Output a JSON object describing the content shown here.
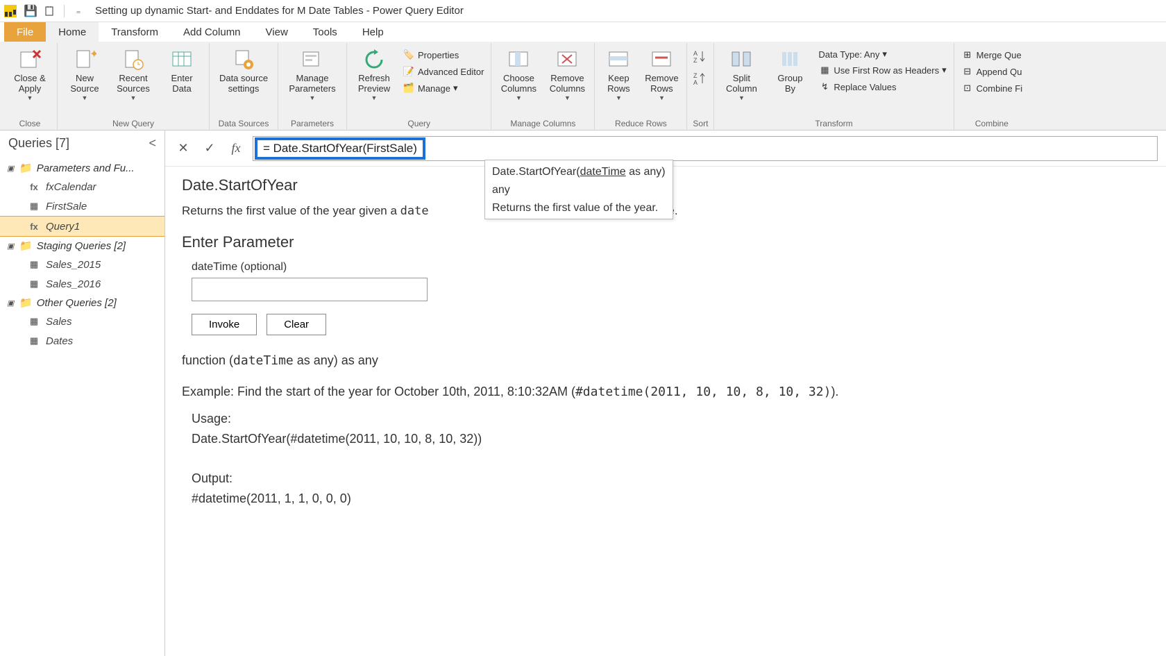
{
  "titlebar": {
    "title": "Setting up dynamic Start- and Enddates for M Date Tables - Power Query Editor"
  },
  "tabs": {
    "file": "File",
    "home": "Home",
    "transform": "Transform",
    "addcolumn": "Add Column",
    "view": "View",
    "tools": "Tools",
    "help": "Help"
  },
  "ribbon": {
    "close": {
      "label": "Close &\nApply",
      "group": "Close"
    },
    "newquery": {
      "newsource": "New\nSource",
      "recentsources": "Recent\nSources",
      "enterdata": "Enter\nData",
      "group": "New Query"
    },
    "datasources": {
      "settings": "Data source\nsettings",
      "group": "Data Sources"
    },
    "parameters": {
      "manage": "Manage\nParameters",
      "group": "Parameters"
    },
    "query": {
      "refresh": "Refresh\nPreview",
      "properties": "Properties",
      "advanced": "Advanced Editor",
      "manage": "Manage",
      "group": "Query"
    },
    "managecols": {
      "choose": "Choose\nColumns",
      "remove": "Remove\nColumns",
      "group": "Manage Columns"
    },
    "reducerows": {
      "keep": "Keep\nRows",
      "remove": "Remove\nRows",
      "group": "Reduce Rows"
    },
    "sort": {
      "group": "Sort"
    },
    "transform": {
      "split": "Split\nColumn",
      "groupby": "Group\nBy",
      "datatype": "Data Type: Any",
      "firstrow": "Use First Row as Headers",
      "replace": "Replace Values",
      "group": "Transform"
    },
    "combine": {
      "merge": "Merge Que",
      "append": "Append Qu",
      "combinefiles": "Combine Fi",
      "group": "Combine"
    }
  },
  "sidebar": {
    "title": "Queries [7]",
    "groups": [
      {
        "label": "Parameters and Fu...",
        "items": [
          {
            "name": "fxCalendar",
            "type": "fx"
          },
          {
            "name": "FirstSale",
            "type": "table"
          },
          {
            "name": "Query1",
            "type": "fx",
            "selected": true
          }
        ]
      },
      {
        "label": "Staging Queries [2]",
        "items": [
          {
            "name": "Sales_2015",
            "type": "table"
          },
          {
            "name": "Sales_2016",
            "type": "table"
          }
        ]
      },
      {
        "label": "Other Queries [2]",
        "items": [
          {
            "name": "Sales",
            "type": "table"
          },
          {
            "name": "Dates",
            "type": "table"
          }
        ]
      }
    ]
  },
  "formula": {
    "text_prefix": "= Date.StartOfYear(",
    "text_arg": "FirstSale",
    "text_suffix": ")"
  },
  "tooltip": {
    "sig_pre": "Date.StartOfYear(",
    "sig_param": "dateTime",
    "sig_post": " as any)",
    "returns": "any",
    "desc": "Returns the first value of the year."
  },
  "doc": {
    "title": "Date.StartOfYear",
    "returns_pre": "Returns the first value of the year given a ",
    "returns_code": "date",
    "returns_post": "e.",
    "enter_param": "Enter Parameter",
    "param_label": "dateTime (optional)",
    "invoke": "Invoke",
    "clear": "Clear",
    "funcline_pre": "function (",
    "funcline_code": "dateTime",
    "funcline_mid": " as any) as any",
    "example_pre": "Example: Find the start of the year for October 10th, 2011, 8:10:32AM (",
    "example_code": "#datetime(2011, 10, 10, 8, 10, 32)",
    "example_post": ").",
    "usage_label": "Usage:",
    "usage_code": "Date.StartOfYear(#datetime(2011, 10, 10, 8, 10, 32))",
    "output_label": "Output:",
    "output_code": "#datetime(2011, 1, 1, 0, 0, 0)"
  }
}
